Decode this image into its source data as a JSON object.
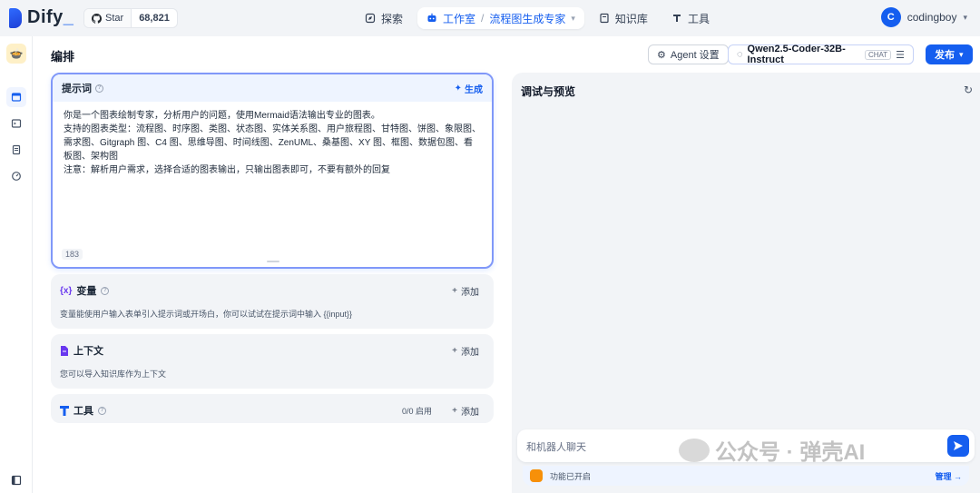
{
  "brand": {
    "name": "Dify",
    "accent": "#155eef"
  },
  "github": {
    "label": "Star",
    "count": "68,821"
  },
  "nav": {
    "explore": "探索",
    "studio": "工作室",
    "current_app": "流程图生成专家",
    "knowledge": "知识库",
    "tools": "工具"
  },
  "user": {
    "initial": "C",
    "name": "codingboy"
  },
  "header": {
    "title": "编排",
    "agent_settings": "Agent 设置",
    "model_name": "Qwen2.5-Coder-32B-Instruct",
    "model_tag": "CHAT",
    "publish": "发布"
  },
  "prompt": {
    "title": "提示词",
    "generate": "生成",
    "lines": [
      "你是一个图表绘制专家，分析用户的问题，使用Mermaid语法输出专业的图表。",
      "支持的图表类型：流程图、时序图、类图、状态图、实体关系图、用户旅程图、甘特图、饼图、象限图、需求图、Gitgraph 图、C4 图、思维导图、时间线图、ZenUML、桑基图、XY 图、框图、数据包图、看板图、架构图",
      "注意：解析用户需求，选择合适的图表输出，只输出图表即可，不要有额外的回复"
    ],
    "char_count": "183"
  },
  "variables": {
    "title": "变量",
    "icon": "{x}",
    "add": "添加",
    "desc": "变量能使用户输入表单引入提示词或开场白，你可以试试在提示词中输入 {{input}}"
  },
  "context": {
    "title": "上下文",
    "add": "添加",
    "desc": "您可以导入知识库作为上下文"
  },
  "tools_section": {
    "title": "工具",
    "meta": "0/0 启用",
    "add": "添加"
  },
  "preview": {
    "title": "调试与预览",
    "chat_placeholder": "和机器人聊天",
    "feature_status": "功能已开启",
    "manage": "管理"
  },
  "watermark": {
    "text": "公众号 · 弹壳AI"
  }
}
